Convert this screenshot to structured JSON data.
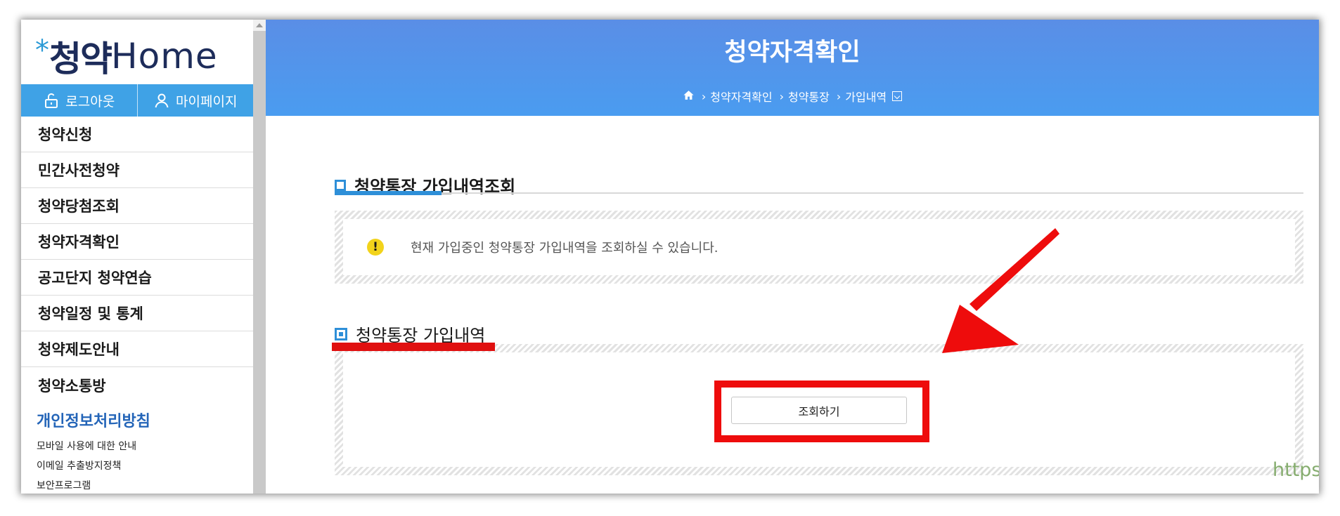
{
  "logo": {
    "star": "*",
    "text": "청약",
    "home": "Home"
  },
  "account": {
    "logout_label": "로그아웃",
    "mypage_label": "마이페이지"
  },
  "nav": {
    "items": [
      {
        "label": "청약신청"
      },
      {
        "label": "민간사전청약"
      },
      {
        "label": "청약당첨조회"
      },
      {
        "label": "청약자격확인"
      },
      {
        "label": "공고단지 청약연습"
      },
      {
        "label": "청약일정 및 통계"
      },
      {
        "label": "청약제도안내"
      },
      {
        "label": "청약소통방"
      }
    ]
  },
  "privacy": {
    "title": "개인정보처리방침",
    "links": [
      "모바일 사용에 대한 안내",
      "이메일 추출방지정책",
      "보안프로그램"
    ]
  },
  "header": {
    "title": "청약자격확인",
    "breadcrumb": [
      "청약자격확인",
      "청약통장",
      "가입내역"
    ]
  },
  "section1": {
    "title": "청약통장 가입내역조회",
    "notice": "현재 가입중인 청약통장 가입내역을 조회하실 수 있습니다."
  },
  "section2": {
    "title": "청약통장 가입내역",
    "query_button": "조회하기"
  },
  "watermark": "https://paramonecompany.com/",
  "colors": {
    "accent": "#3fa2e6",
    "header": "#4a9cf0",
    "highlight_red": "#ee0c0c",
    "warning": "#f2d31b",
    "privacy_blue": "#2465b8"
  }
}
